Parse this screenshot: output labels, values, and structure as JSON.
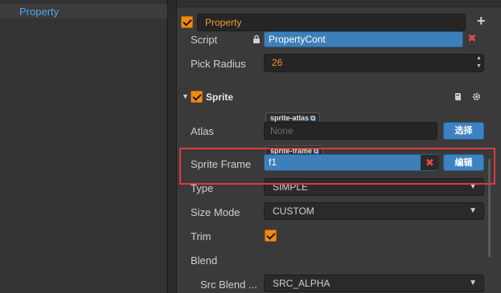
{
  "hierarchy": {
    "selected_node": "Property"
  },
  "component_property": {
    "enabled": true,
    "name": "Property",
    "script_label": "Script",
    "script_value": "PropertyCont",
    "pick_radius_label": "Pick Radius",
    "pick_radius_value": "26"
  },
  "sprite": {
    "enabled": true,
    "title": "Sprite",
    "atlas_tag": "sprite-atlas",
    "atlas_label": "Atlas",
    "atlas_value": "None",
    "atlas_button": "选择",
    "frame_tag": "sprite-frame",
    "frame_label": "Sprite Frame",
    "frame_value": "f1",
    "frame_button": "编辑",
    "type_label": "Type",
    "type_value": "SIMPLE",
    "size_mode_label": "Size Mode",
    "size_mode_value": "CUSTOM",
    "trim_label": "Trim",
    "trim_checked": true,
    "blend_label": "Blend",
    "src_blend_label": "Src Blend ...",
    "src_blend_value": "SRC_ALPHA"
  },
  "icons": {
    "add": "plus-icon",
    "lock": "lock-icon",
    "clear": "close-icon",
    "collapse": "triangle-down-icon",
    "help": "book-icon",
    "settings": "gear-icon",
    "link": "external-link-icon"
  },
  "colors": {
    "accent_orange": "#f28b12",
    "selection_blue": "#3d7fb8",
    "highlight_red": "#e1393f",
    "node_blue": "#4aa8f5"
  }
}
